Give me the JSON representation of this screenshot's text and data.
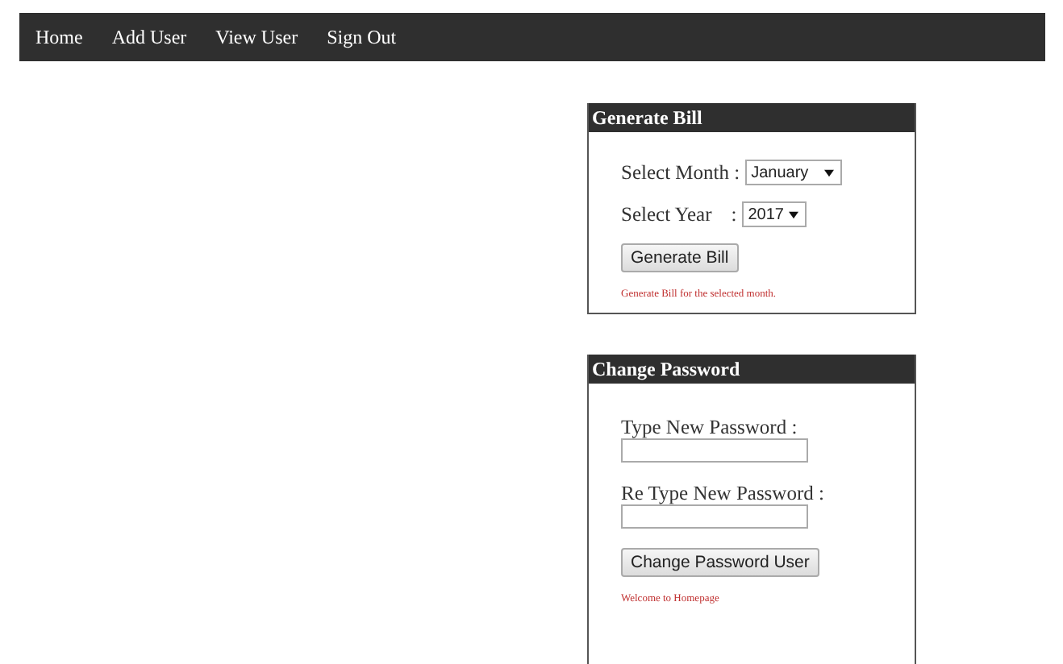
{
  "nav": {
    "items": [
      {
        "label": "Home"
      },
      {
        "label": "Add User"
      },
      {
        "label": "View User"
      },
      {
        "label": "Sign Out"
      }
    ]
  },
  "generate_bill": {
    "title": "Generate Bill",
    "month": {
      "label": "Select Month :",
      "value": "January"
    },
    "year": {
      "label": "Select Year",
      "separator": ":",
      "value": "2017"
    },
    "button": "Generate Bill",
    "message": "Generate Bill for the selected month."
  },
  "change_password": {
    "title": "Change Password",
    "fields": [
      {
        "label": "Type New Password :"
      },
      {
        "label": "Re Type New Password :"
      }
    ],
    "button": "Change Password User",
    "message": "Welcome to Homepage"
  }
}
